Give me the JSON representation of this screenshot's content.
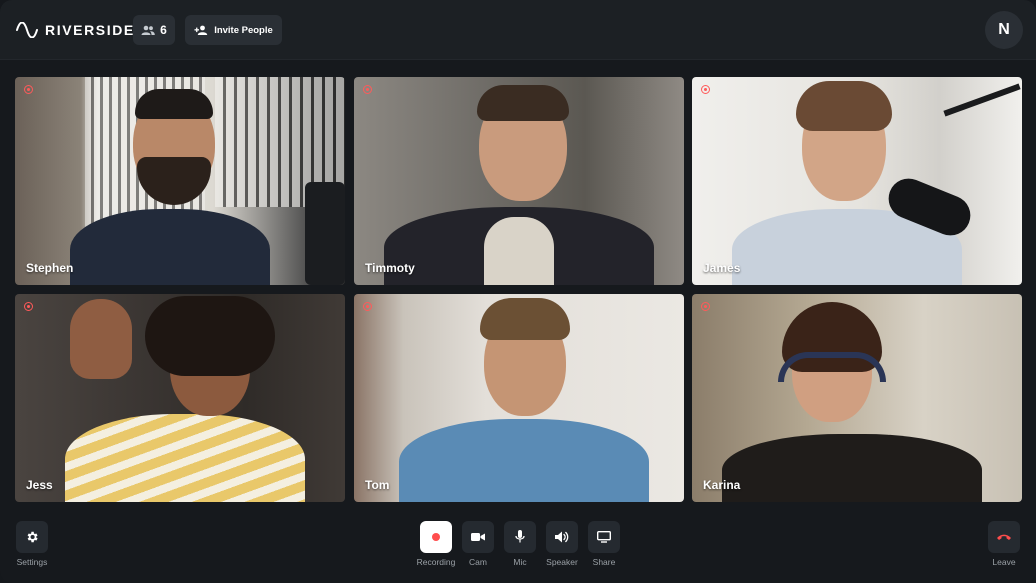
{
  "app": {
    "logo_text": "RIVERSIDE"
  },
  "topbar": {
    "participant_count": "6",
    "invite_label": "Invite People",
    "avatar_initial": "N"
  },
  "participants": [
    {
      "name": "Stephen",
      "bg": "#d9d6cf"
    },
    {
      "name": "Timmoty",
      "bg": "#6b6a66"
    },
    {
      "name": "James",
      "bg": "#ecebe8"
    },
    {
      "name": "Jess",
      "bg": "#3a3430"
    },
    {
      "name": "Tom",
      "bg": "#d9d6d0"
    },
    {
      "name": "Karina",
      "bg": "#c9c0b2"
    }
  ],
  "controls": {
    "settings": "Settings",
    "recording": "Recording",
    "cam": "Cam",
    "mic": "Mic",
    "speaker": "Speaker",
    "share": "Share",
    "leave": "Leave"
  },
  "colors": {
    "record_red": "#ff5a5a",
    "leave_red": "#ff4d4d",
    "surface": "#252a30"
  },
  "icons": [
    "logo-wave-icon",
    "people-icon",
    "add-person-icon",
    "record-dot-icon",
    "gear-icon",
    "camera-icon",
    "mic-icon",
    "speaker-icon",
    "screen-share-icon",
    "phone-hangup-icon"
  ]
}
